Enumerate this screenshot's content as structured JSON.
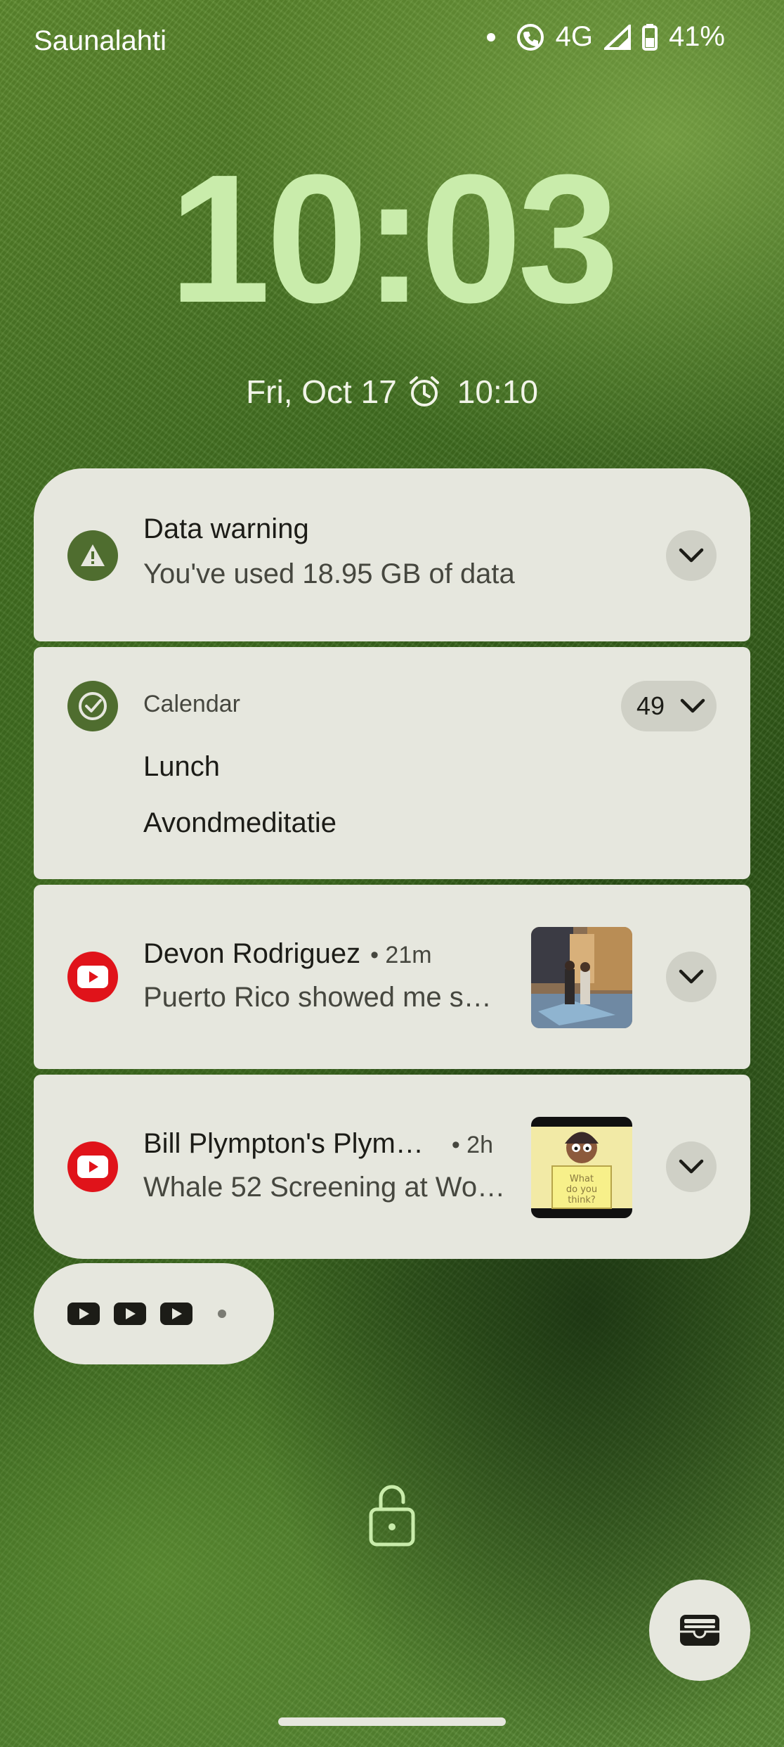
{
  "status_bar": {
    "carrier": "Saunalahti",
    "network": "4G",
    "battery": "41%"
  },
  "lockscreen": {
    "time": "10:03",
    "date": "Fri, Oct 17",
    "alarm": "10:10"
  },
  "notifications": [
    {
      "app_icon": "warning-icon",
      "title": "Data warning",
      "text": "You've used 18.95 GB of data"
    },
    {
      "app": "Calendar",
      "app_icon": "check-circle-icon",
      "count": "49",
      "items": [
        "Lunch",
        "Avondmeditatie"
      ]
    },
    {
      "app_icon": "youtube-icon",
      "title": "Devon Rodriguez",
      "time": "• 21m",
      "text": "Puerto Rico showed me s…"
    },
    {
      "app_icon": "youtube-icon",
      "title": "Bill Plympton's Plym…",
      "time": "• 2h",
      "text": "Whale 52 Screening at Wo…",
      "thumb_text": "What do you think?"
    }
  ],
  "colors": {
    "clock": "#c9ecab",
    "card_bg": "#e6e7de",
    "youtube_red": "#e0131a",
    "icon_green": "#4f6d2f"
  }
}
